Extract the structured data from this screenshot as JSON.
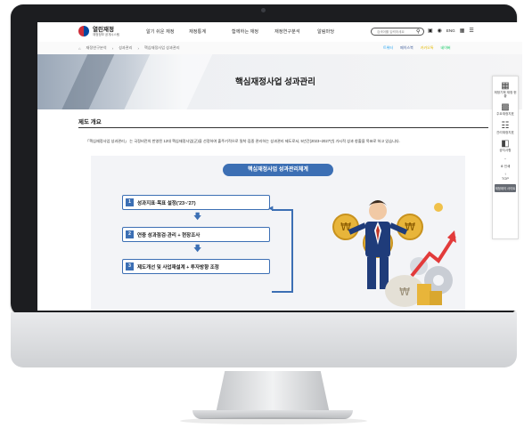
{
  "header": {
    "logo_title": "열린재정",
    "logo_subtitle": "재정정보 공개시스템",
    "nav": [
      "알기 쉬운 재정",
      "재정통계",
      "함께하는 재정",
      "재정연구분석",
      "알림마당"
    ],
    "search_placeholder": "검색어를 입력하세요",
    "lang_label": "ENG"
  },
  "breadcrumb": {
    "items": [
      "재정연구분석",
      "성과관리",
      "핵심재정사업 성과관리"
    ]
  },
  "sns": {
    "twitter": "트위터",
    "facebook": "페이스북",
    "kakao": "카카오톡",
    "naver": "네이버"
  },
  "banner": {
    "title": "핵심재정사업 성과관리"
  },
  "sidebar": {
    "items": [
      "재정기획 재정 현황",
      "주요재정지표",
      "관리재정지표",
      "공지사항"
    ],
    "print_label": "인쇄",
    "top_label": "TOP",
    "share_label": "재정데이 사이트"
  },
  "content": {
    "section_title": "제도 개요",
    "intro": "「핵심재정사업 성과관리」 는 국정비전의 반영된 12대 핵심재정사업(군)을 선정하여 출주기적으로 밀착·집중 관리하는 성과관리 제도로서, 5년간(2023~2027년) 가시적 성과 창출을 목표로 하고 있습니다.",
    "diagram_title": "핵심재정사업 성과관리체계",
    "steps": [
      {
        "num": "1",
        "label": "성과지표·목표 설정('23~'27)"
      },
      {
        "num": "2",
        "label": "연중 성과점검·관리 + 현장조사"
      },
      {
        "num": "3",
        "label": "제도개선 및 사업재설계 + 투자방향 조정"
      }
    ]
  },
  "colors": {
    "accent": "#3c6fb4",
    "bezel": "#1c1d20"
  }
}
